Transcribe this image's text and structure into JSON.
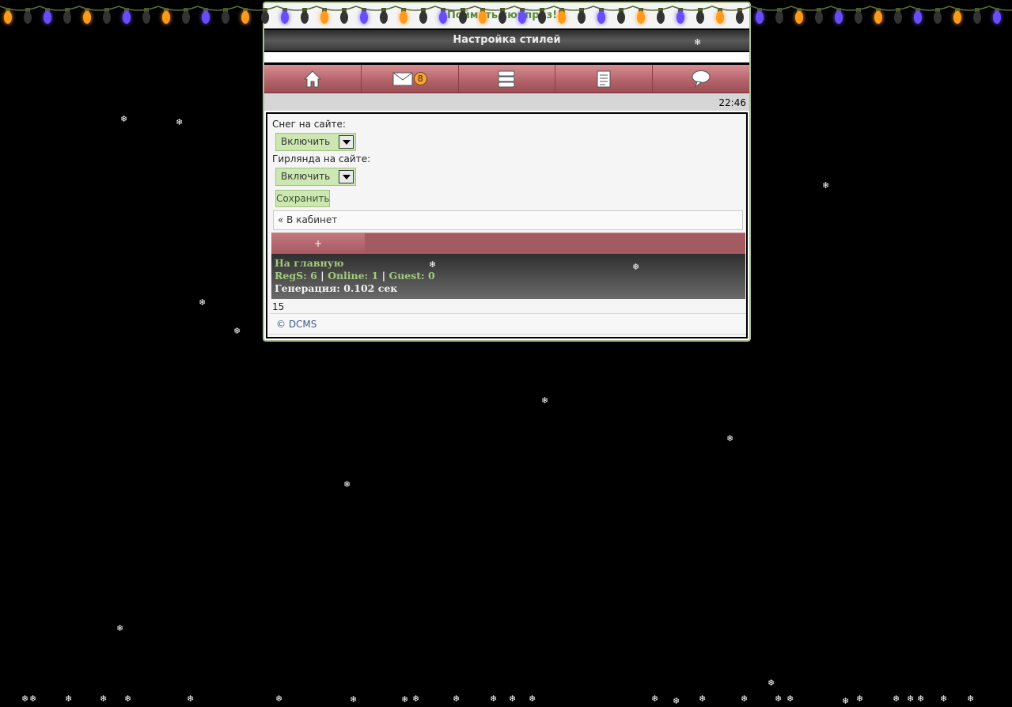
{
  "announcement": "Поймать сюрприз!!!",
  "page_title": "Настройка стилей",
  "nav": {
    "items": [
      {
        "icon": "home-icon"
      },
      {
        "icon": "mail-icon",
        "badge": "8"
      },
      {
        "icon": "database-icon"
      },
      {
        "icon": "document-icon"
      },
      {
        "icon": "chat-bubble-icon"
      }
    ]
  },
  "time": "22:46",
  "form": {
    "snow_label": "Снег на сайте:",
    "snow_value": "Включить",
    "garland_label": "Гирлянда на сайте:",
    "garland_value": "Включить",
    "save_label": "Сохранить"
  },
  "cabinet_link": "« В кабинет",
  "tab_plus": "+",
  "footer": {
    "home_link": "На главную",
    "regs_label": "RegS: 6",
    "online_label": "Online: 1",
    "guest_label": "Guest: 0",
    "separator": "|",
    "generation": "Генерация: 0.102 сек"
  },
  "counter": "15",
  "copyright": "© DCMS",
  "colors": {
    "nav_gradient": "#b6646b",
    "select_bg": "#cde7b2",
    "footer_green": "#a4cb7e",
    "badge": "#f7a23a"
  },
  "snowflake_glyph": "❄"
}
